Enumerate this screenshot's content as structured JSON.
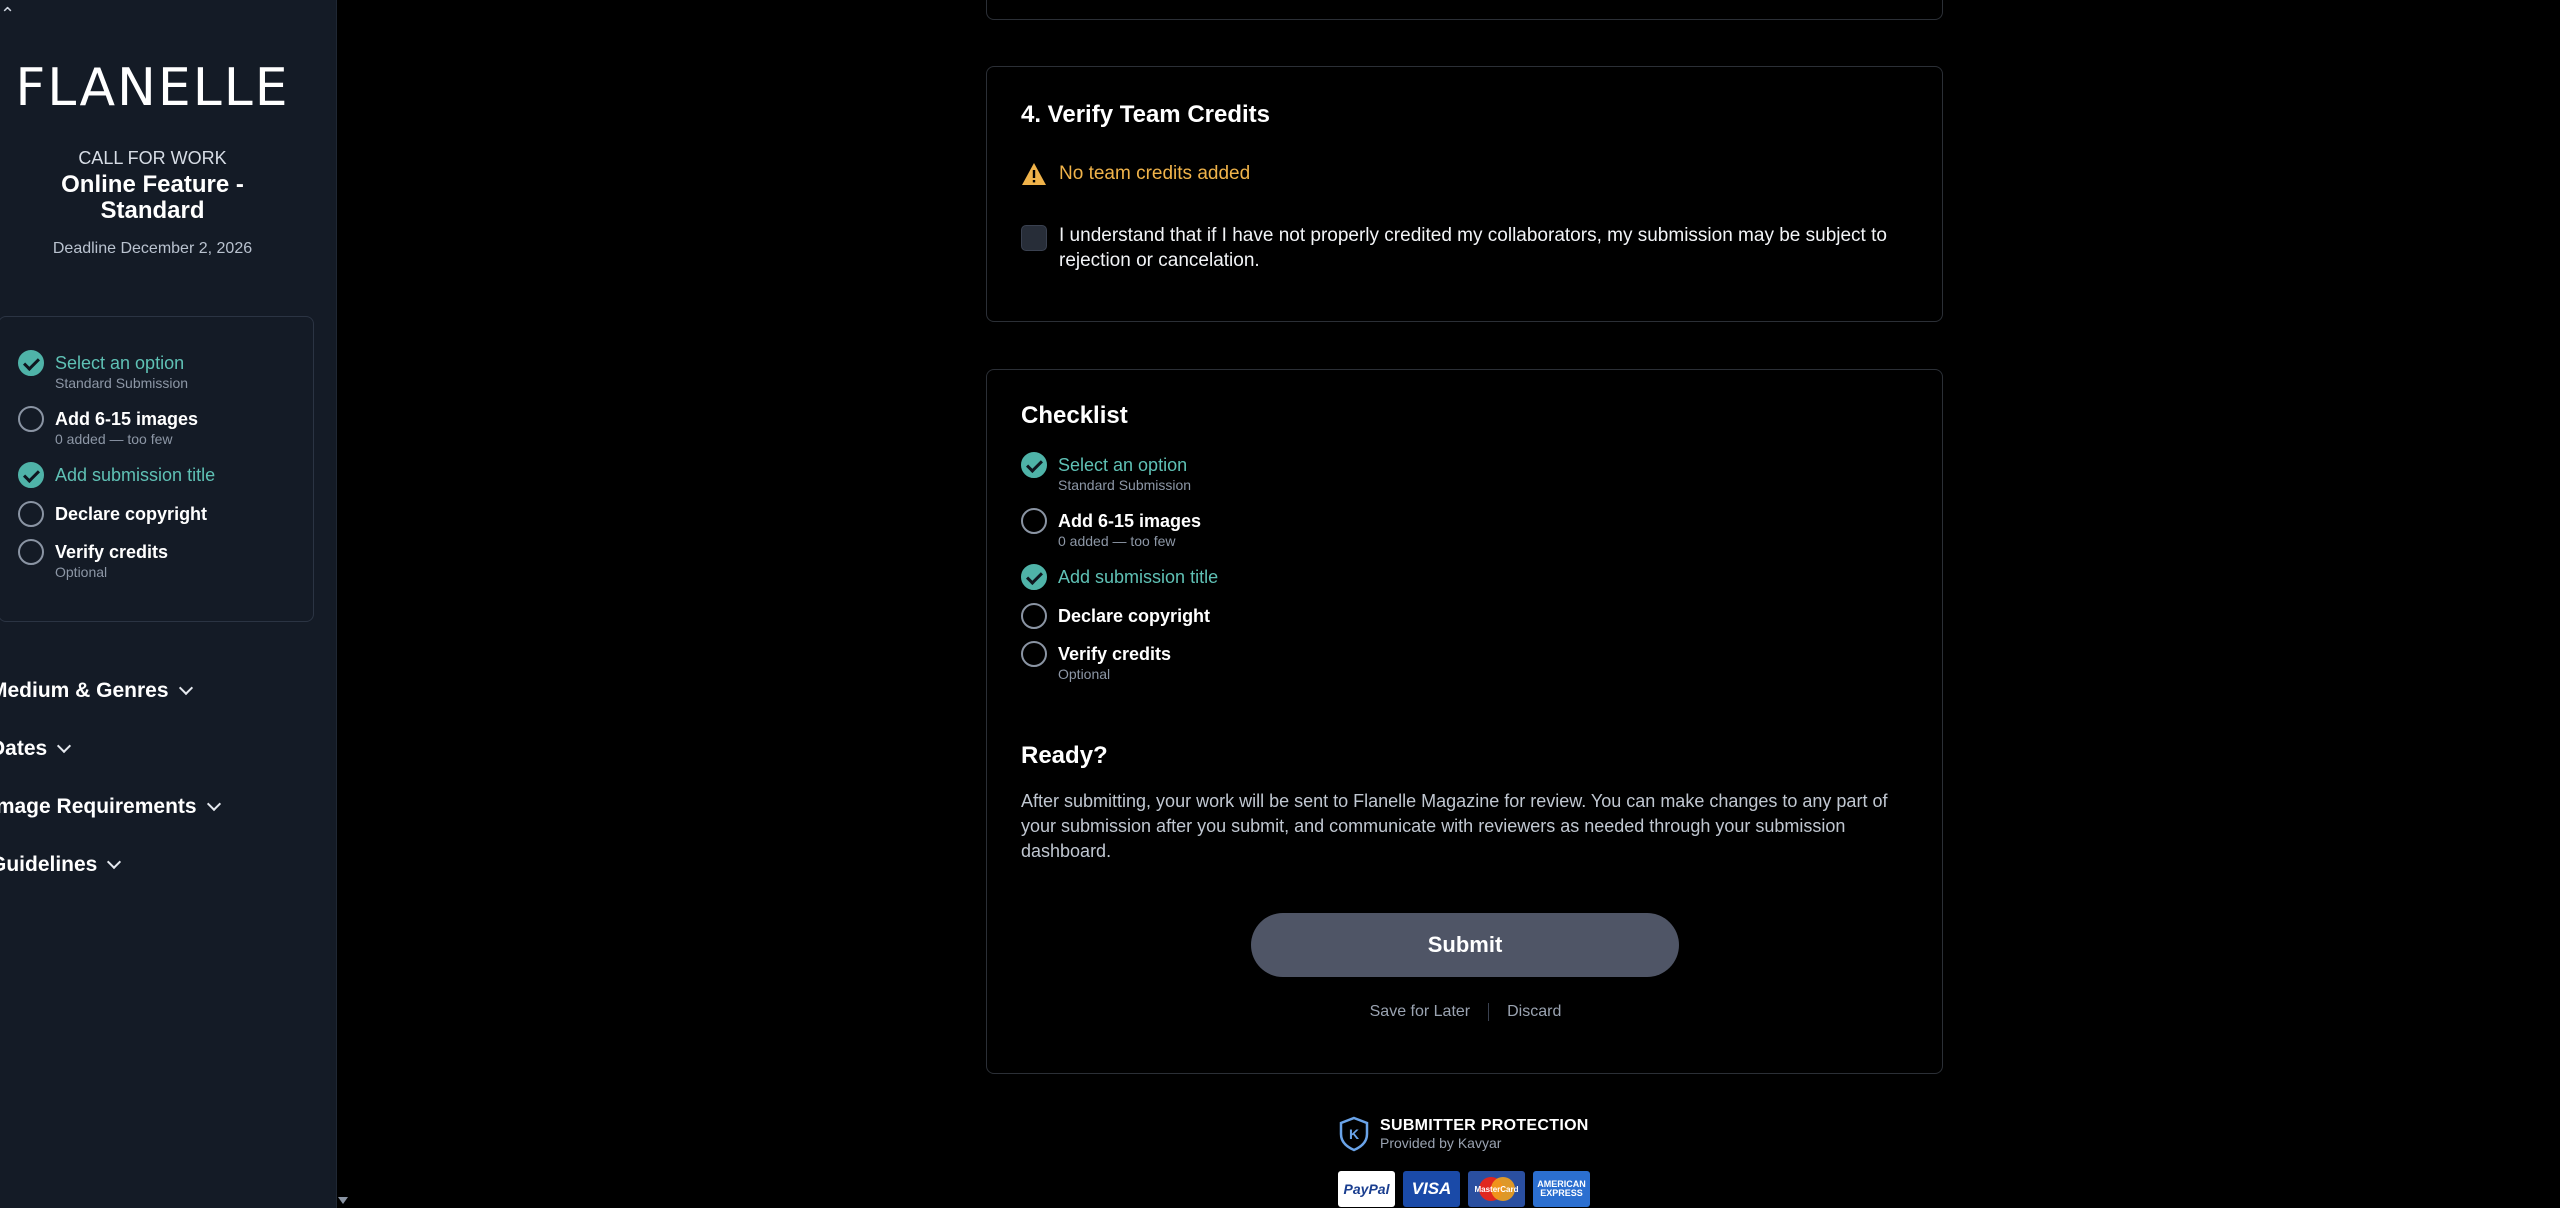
{
  "sidebar": {
    "brand": "FLANELLE",
    "call_label": "CALL FOR WORK",
    "call_title": "Online Feature - Standard",
    "deadline": "Deadline December 2, 2026",
    "steps": [
      {
        "label": "Select an option",
        "sub": "Standard Submission",
        "done": true
      },
      {
        "label": "Add 6-15 images",
        "sub": "0 added — too few",
        "done": false
      },
      {
        "label": "Add submission title",
        "sub": "",
        "done": true
      },
      {
        "label": "Declare copyright",
        "sub": "",
        "done": false
      },
      {
        "label": "Verify credits",
        "sub": "Optional",
        "done": false
      }
    ],
    "accordions": [
      "Medium & Genres",
      "Dates",
      "Image Requirements",
      "Guidelines"
    ]
  },
  "credits": {
    "title": "4. Verify Team Credits",
    "warning": "No team credits added",
    "agreement": "I understand that if I have not properly credited my collaborators, my submission may be subject to rejection or cancelation."
  },
  "checklist": {
    "title": "Checklist",
    "steps": [
      {
        "label": "Select an option",
        "sub": "Standard Submission",
        "done": true
      },
      {
        "label": "Add 6-15 images",
        "sub": "0 added — too few",
        "done": false
      },
      {
        "label": "Add submission title",
        "sub": "",
        "done": true
      },
      {
        "label": "Declare copyright",
        "sub": "",
        "done": false
      },
      {
        "label": "Verify credits",
        "sub": "Optional",
        "done": false
      }
    ],
    "ready_title": "Ready?",
    "ready_text": "After submitting, your work will be sent to Flanelle Magazine for review. You can make changes to any part of your submission after you submit, and communicate with reviewers as needed through your submission dashboard.",
    "submit_label": "Submit",
    "save_label": "Save for Later",
    "discard_label": "Discard"
  },
  "protection": {
    "title": "SUBMITTER PROTECTION",
    "provider": "Provided by Kavyar",
    "badge_letter": "K",
    "payments": {
      "paypal": "PayPal",
      "visa": "VISA",
      "mastercard": "MasterCard",
      "amex": "AMERICAN EXPRESS"
    }
  },
  "colors": {
    "accent": "#4fb3a8",
    "warning": "#f0b34a",
    "sidebar_bg": "#141b26",
    "button": "#4f5566"
  }
}
